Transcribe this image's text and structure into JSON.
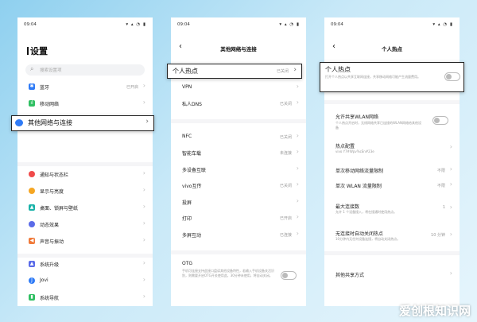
{
  "status": {
    "time": "09:04"
  },
  "colors": {
    "accent": "#2f7bf6",
    "bg": "#bfe6f7"
  },
  "phone1": {
    "title": "设置",
    "search_placeholder": "搜索设置项",
    "items": [
      {
        "label": "蓝牙",
        "value": "已开启",
        "icon": "bluetooth-icon",
        "color": "#2f7bf6",
        "glyph": "✱"
      },
      {
        "label": "移动网络",
        "value": "",
        "icon": "signal-bars-icon",
        "color": "#2fbf62",
        "glyph": "ıl"
      },
      {
        "label": "其他网络与连接",
        "value": "",
        "icon": "network-icon",
        "color": "#2f7bf6",
        "glyph": ""
      },
      {
        "label": "通知与状态栏",
        "value": "",
        "icon": "bell-icon",
        "color": "#f04a4a",
        "glyph": "●"
      },
      {
        "label": "显示与亮度",
        "value": "",
        "icon": "sun-icon",
        "color": "#f5a623",
        "glyph": "☀"
      },
      {
        "label": "桌面、锁屏与壁纸",
        "value": "",
        "icon": "mountain-icon",
        "color": "#19b2a8",
        "glyph": "▲"
      },
      {
        "label": "动态效果",
        "value": "",
        "icon": "motion-icon",
        "color": "#5a6be8",
        "glyph": "◉"
      },
      {
        "label": "声音与振动",
        "value": "",
        "icon": "speaker-icon",
        "color": "#f07a3a",
        "glyph": "◀"
      },
      {
        "label": "系统升级",
        "value": "",
        "icon": "upgrade-icon",
        "color": "#5a6be8",
        "glyph": "▲"
      },
      {
        "label": "Jovi",
        "value": "",
        "icon": "jovi-icon",
        "color": "#2f7bf6",
        "glyph": "J"
      },
      {
        "label": "系统导航",
        "value": "",
        "icon": "phone-nav-icon",
        "color": "#2fbf62",
        "glyph": "▮"
      }
    ]
  },
  "phone2": {
    "title": "其他网络与连接",
    "items": [
      {
        "label": "个人热点",
        "value": "已关闭"
      },
      {
        "label": "VPN",
        "value": ""
      },
      {
        "label": "私人DNS",
        "value": "已关闭"
      },
      {
        "label": "NFC",
        "value": "已关闭"
      },
      {
        "label": "智能车载",
        "value": "未连接"
      },
      {
        "label": "多设备互联",
        "value": ""
      },
      {
        "label": "vivo互传",
        "value": "已关闭"
      },
      {
        "label": "投屏",
        "value": ""
      },
      {
        "label": "打印",
        "value": "已开启"
      },
      {
        "label": "多屏互动",
        "value": "已连接"
      }
    ],
    "otg": {
      "label": "OTG",
      "desc": "手机可连接支持此接口盘读其他设备特性，若输入手机设备关活识别，则需要开启OTG开关使用此，30分钟未使用，将自动关闭。"
    }
  },
  "phone3": {
    "title": "个人热点",
    "hotspot": {
      "label": "个人热点",
      "desc": "打开个人热点以共享互联网连接，共享移动网络可能产生流量费用。"
    },
    "share_wlan": {
      "label": "允许共享WLAN网络",
      "desc": "个人热点开启时，无线网络共享已连接的WLAN网络给其他设备"
    },
    "config": {
      "label": "热点配置",
      "sub": "vivo Y7#Wpv%cEn#23e"
    },
    "limit_mobile": {
      "label": "单次移动网络流量限制",
      "value": "不限"
    },
    "limit_wlan": {
      "label": "单次 WLAN 流量限制",
      "value": "不限"
    },
    "max_conn": {
      "label": "最大连接数",
      "value": "1",
      "desc": "允许 1 个设备接入，将在接通时使用热点。"
    },
    "auto_off": {
      "label": "无连接时自动关闭热点",
      "value": "10 分钟",
      "desc": "10分钟内无任何设备连接，将自动关闭热点。"
    },
    "other_share": {
      "label": "其他共享方式"
    }
  },
  "watermark": "爱创根知识网"
}
